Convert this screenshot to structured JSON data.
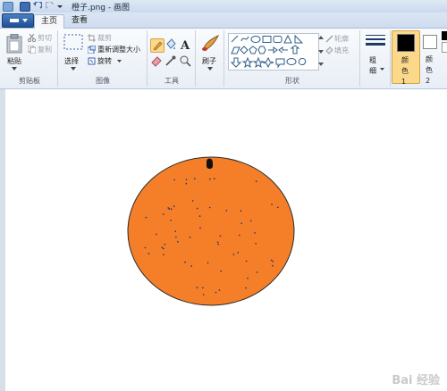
{
  "window": {
    "title": "橙子.png - 画图"
  },
  "tabs": {
    "home": "主页",
    "view": "查看"
  },
  "clipboard": {
    "paste": "粘贴",
    "cut": "剪切",
    "copy": "复制",
    "group": "剪贴板"
  },
  "image": {
    "select": "选择",
    "crop": "裁剪",
    "resize": "重新调整大小",
    "rotate": "旋转",
    "group": "图像"
  },
  "tools": {
    "group": "工具"
  },
  "brush": {
    "label": "刷子"
  },
  "shapes": {
    "outline": "轮廓",
    "fill": "填充",
    "group": "形状"
  },
  "size": {
    "label": "粗细"
  },
  "colors": {
    "color1": "颜色 1",
    "color2": "颜色 2",
    "color1_value": "#000000",
    "color2_value": "#ffffff"
  },
  "canvas": {
    "fill_color": "#f47f28",
    "stem_color": "#111111"
  },
  "watermark": "Bai 经验"
}
